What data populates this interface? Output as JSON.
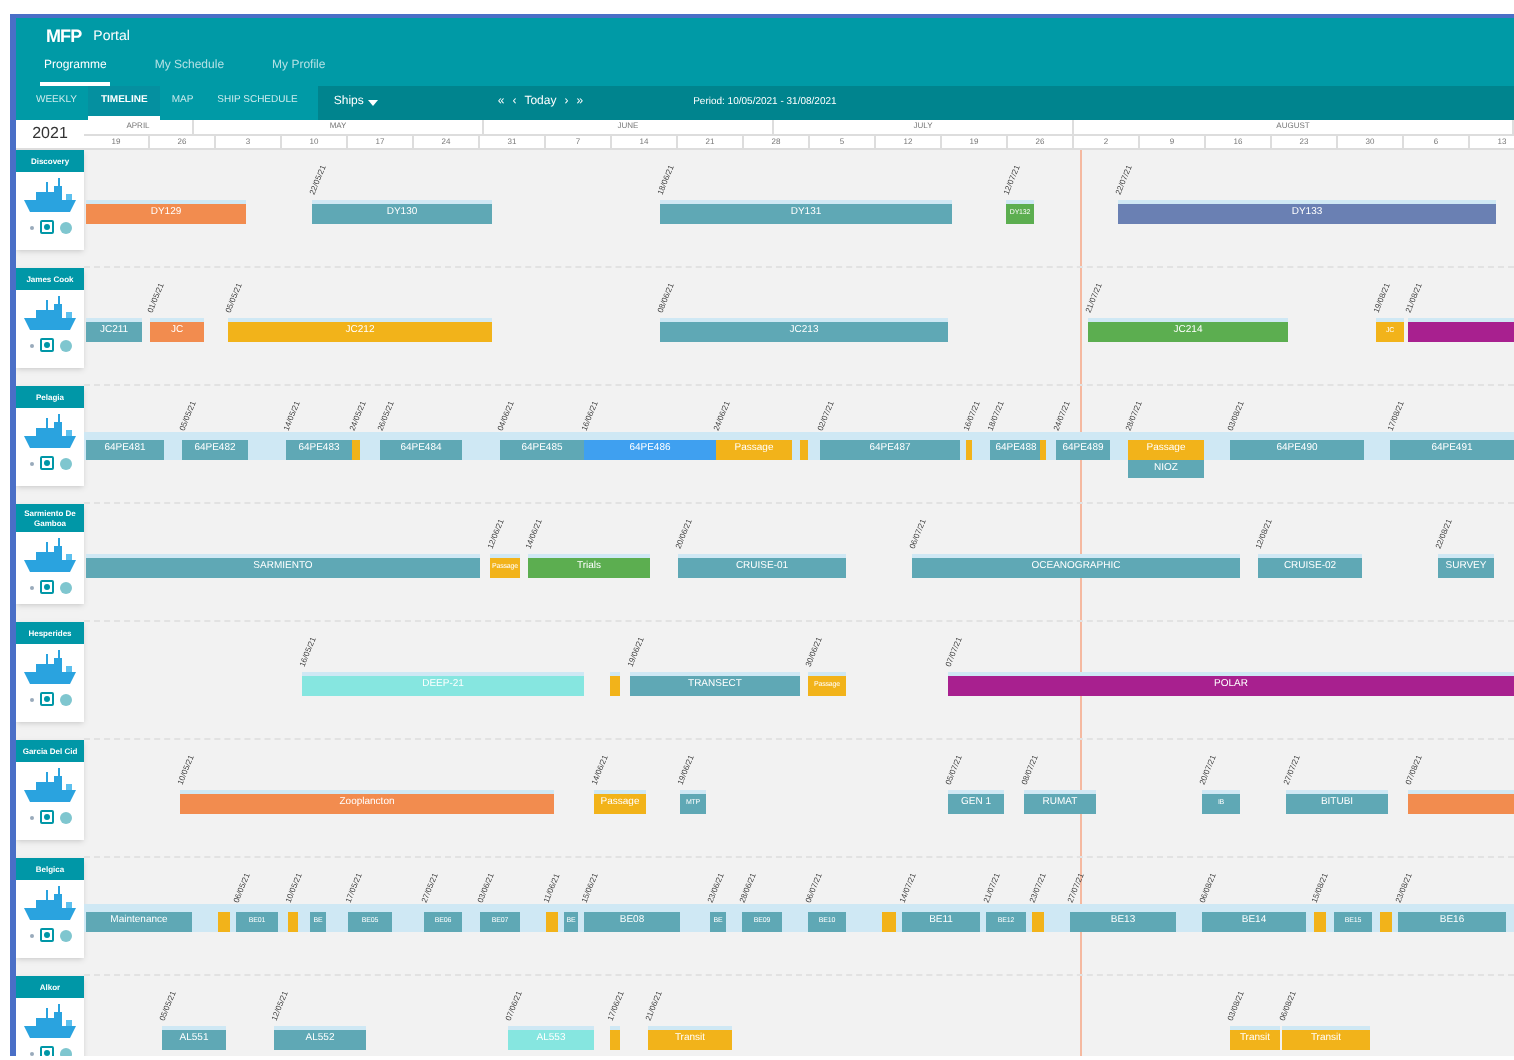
{
  "app": {
    "logo": "MFP",
    "title": "Portal"
  },
  "nav": [
    {
      "label": "Programme",
      "selected": true
    },
    {
      "label": "My Schedule",
      "selected": false
    },
    {
      "label": "My Profile",
      "selected": false
    }
  ],
  "views": [
    {
      "label": "WEEKLY",
      "selected": false
    },
    {
      "label": "TIMELINE",
      "selected": true
    },
    {
      "label": "MAP",
      "selected": false
    },
    {
      "label": "SHIP SCHEDULE",
      "selected": false
    }
  ],
  "filter": {
    "label": "Ships"
  },
  "pager": {
    "first": "«",
    "prev": "‹",
    "today": "Today",
    "next": "›",
    "last": "»"
  },
  "period": "Period: 10/05/2021 - 31/08/2021",
  "timeline": {
    "year": "2021",
    "months": [
      "APRIL",
      "MAY",
      "JUNE",
      "JULY",
      "AUGUST"
    ],
    "weeks": [
      "19",
      "26",
      "3",
      "10",
      "17",
      "24",
      "31",
      "7",
      "14",
      "21",
      "28",
      "5",
      "12",
      "19",
      "26",
      "2",
      "9",
      "16",
      "23",
      "30",
      "6",
      "13"
    ]
  },
  "ships": [
    {
      "name": "Discovery",
      "band": false,
      "bars": [
        {
          "label": "DY129",
          "color": "#f28c4f"
        },
        {
          "label": "DY130",
          "color": "#5fa8b5",
          "date": "22/05/21"
        },
        {
          "label": "DY131",
          "color": "#5fa8b5",
          "date": "18/06/21"
        },
        {
          "label": "DY132",
          "color": "#5cae50",
          "date": "12/07/21"
        },
        {
          "label": "DY133",
          "color": "#6a80b3",
          "date": "22/07/21"
        }
      ]
    },
    {
      "name": "James Cook",
      "band": false,
      "bars": [
        {
          "label": "JC211",
          "color": "#5fa8b5"
        },
        {
          "label": "JC",
          "color": "#f28c4f",
          "date": "01/05/21"
        },
        {
          "label": "JC212",
          "color": "#f2b31a",
          "date": "05/05/21"
        },
        {
          "label": "JC213",
          "color": "#5fa8b5",
          "date": "08/06/21"
        },
        {
          "label": "JC214",
          "color": "#5cae50",
          "date": "21/07/21"
        },
        {
          "label": "JC",
          "color": "#f2b31a",
          "date": "19/08/21"
        },
        {
          "color": "#a8208f",
          "date": "21/08/21"
        }
      ]
    },
    {
      "name": "Pelagia",
      "band": true,
      "bars": [
        {
          "label": "64PE481",
          "color": "#5fa8b5"
        },
        {
          "label": "64PE482",
          "color": "#5fa8b5",
          "date": "05/05/21"
        },
        {
          "label": "64PE483",
          "color": "#5fa8b5",
          "date": "14/05/21"
        },
        {
          "color": "#f2b31a",
          "date": "24/05/21"
        },
        {
          "label": "64PE484",
          "color": "#5fa8b5",
          "date": "26/05/21"
        },
        {
          "label": "64PE485",
          "color": "#5fa8b5",
          "date": "04/06/21"
        },
        {
          "label": "64PE486",
          "color": "#3fa0f0",
          "date": "16/06/21"
        },
        {
          "label": "Passage",
          "color": "#f2b31a",
          "date": "24/06/21"
        },
        {
          "color": "#f2b31a"
        },
        {
          "label": "64PE487",
          "color": "#5fa8b5",
          "date": "02/07/21"
        },
        {
          "color": "#f2b31a",
          "date": "16/07/21"
        },
        {
          "label": "64PE488",
          "color": "#5fa8b5",
          "date": "18/07/21"
        },
        {
          "color": "#f2b31a"
        },
        {
          "label": "64PE489",
          "color": "#5fa8b5",
          "date": "24/07/21"
        },
        {
          "label": "Passage",
          "color": "#f2b31a",
          "date": "28/07/21",
          "below": "NIOZ"
        },
        {
          "label": "64PE490",
          "color": "#5fa8b5",
          "date": "03/08/21"
        },
        {
          "label": "64PE491",
          "color": "#5fa8b5",
          "date": "17/08/21"
        }
      ]
    },
    {
      "name": "Sarmiento De Gamboa",
      "band": false,
      "bars": [
        {
          "label": "SARMIENTO",
          "color": "#5fa8b5"
        },
        {
          "label": "Passage",
          "color": "#f2b31a",
          "date": "12/06/21"
        },
        {
          "label": "Trials",
          "color": "#5cae50",
          "date": "14/06/21"
        },
        {
          "label": "CRUISE-01",
          "color": "#5fa8b5",
          "date": "20/06/21"
        },
        {
          "label": "OCEANOGRAPHIC",
          "color": "#5fa8b5",
          "date": "06/07/21"
        },
        {
          "label": "CRUISE-02",
          "color": "#5fa8b5",
          "date": "12/08/21"
        },
        {
          "label": "SURVEY",
          "color": "#5fa8b5",
          "date": "22/08/21"
        }
      ]
    },
    {
      "name": "Hesperides",
      "band": false,
      "bars": [
        {
          "label": "DEEP-21",
          "color": "#86e6e0",
          "date": "16/05/21"
        },
        {
          "color": "#f2b31a"
        },
        {
          "label": "TRANSECT",
          "color": "#5fa8b5",
          "date": "19/06/21"
        },
        {
          "label": "Passage",
          "color": "#f2b31a",
          "date": "30/06/21"
        },
        {
          "label": "POLAR",
          "color": "#a8208f",
          "date": "07/07/21"
        }
      ]
    },
    {
      "name": "Garcia Del Cid",
      "band": false,
      "bars": [
        {
          "label": "Zooplancton",
          "color": "#f28c4f",
          "date": "10/05/21"
        },
        {
          "label": "Passage",
          "color": "#f2b31a",
          "date": "14/06/21"
        },
        {
          "label": "MTP",
          "color": "#5fa8b5",
          "date": "19/06/21"
        },
        {
          "label": "GEN 1",
          "color": "#5fa8b5",
          "date": "05/07/21"
        },
        {
          "label": "RUMAT",
          "color": "#5fa8b5",
          "date": "08/07/21"
        },
        {
          "label": "IB",
          "color": "#5fa8b5",
          "date": "20/07/21"
        },
        {
          "label": "BITUBI",
          "color": "#5fa8b5",
          "date": "27/07/21"
        },
        {
          "color": "#f28c4f",
          "date": "07/08/21"
        }
      ]
    },
    {
      "name": "Belgica",
      "band": true,
      "bars": [
        {
          "label": "Maintenance",
          "color": "#5fa8b5"
        },
        {
          "color": "#f2b31a"
        },
        {
          "label": "BE01",
          "color": "#5fa8b5",
          "date": "06/05/21"
        },
        {
          "color": "#f2b31a",
          "date": "10/05/21"
        },
        {
          "label": "BE",
          "color": "#5fa8b5"
        },
        {
          "label": "BE05",
          "color": "#5fa8b5",
          "date": "17/05/21"
        },
        {
          "label": "BE06",
          "color": "#5fa8b5",
          "date": "27/05/21"
        },
        {
          "label": "BE07",
          "color": "#5fa8b5",
          "date": "03/06/21"
        },
        {
          "color": "#f2b31a",
          "date": "11/06/21"
        },
        {
          "label": "BE",
          "color": "#5fa8b5"
        },
        {
          "label": "BE08",
          "color": "#5fa8b5",
          "date": "15/06/21"
        },
        {
          "label": "BE",
          "color": "#5fa8b5",
          "date": "23/06/21"
        },
        {
          "label": "BE09",
          "color": "#5fa8b5",
          "date": "28/06/21"
        },
        {
          "label": "BE10",
          "color": "#5fa8b5",
          "date": "06/07/21"
        },
        {
          "color": "#f2b31a"
        },
        {
          "label": "BE11",
          "color": "#5fa8b5",
          "date": "14/07/21"
        },
        {
          "label": "BE12",
          "color": "#5fa8b5",
          "date": "21/07/21"
        },
        {
          "color": "#f2b31a",
          "date": "23/07/21"
        },
        {
          "label": "BE13",
          "color": "#5fa8b5",
          "date": "27/07/21"
        },
        {
          "label": "BE14",
          "color": "#5fa8b5",
          "date": "06/08/21"
        },
        {
          "color": "#f2b31a",
          "date": "15/08/21"
        },
        {
          "label": "BE15",
          "color": "#5fa8b5"
        },
        {
          "color": "#f2b31a"
        },
        {
          "label": "BE16",
          "color": "#5fa8b5",
          "date": "23/08/21"
        }
      ]
    },
    {
      "name": "Alkor",
      "band": false,
      "bars": [
        {
          "label": "AL551",
          "color": "#5fa8b5",
          "date": "05/05/21"
        },
        {
          "label": "AL552",
          "color": "#5fa8b5",
          "date": "12/05/21"
        },
        {
          "label": "AL553",
          "color": "#86e6e0",
          "date": "07/06/21"
        },
        {
          "color": "#f2b31a",
          "date": "17/06/21"
        },
        {
          "label": "Transit",
          "color": "#f2b31a",
          "date": "21/06/21"
        },
        {
          "label": "Transit",
          "color": "#f2b31a",
          "date": "03/08/21"
        },
        {
          "label": "Transit",
          "color": "#f2b31a",
          "date": "06/08/21"
        }
      ]
    }
  ]
}
